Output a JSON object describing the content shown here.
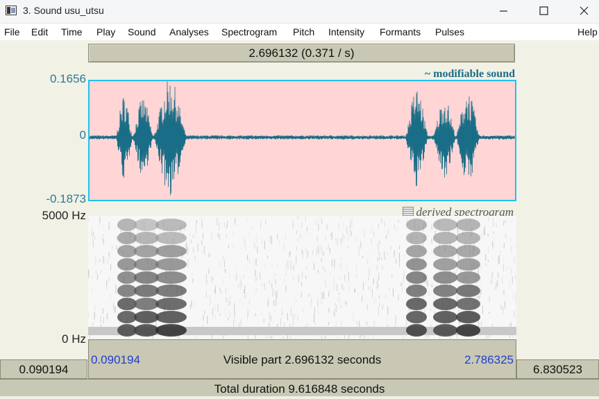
{
  "window": {
    "title": "3. Sound usu_utsu"
  },
  "menu": [
    "File",
    "Edit",
    "Time",
    "Play",
    "Sound",
    "Analyses",
    "Spectrogram",
    "Pitch",
    "Intensity",
    "Formants",
    "Pulses",
    "Help"
  ],
  "selection": {
    "duration_text": "2.696132 (0.371 / s)"
  },
  "waveform": {
    "label": "~ modifiable sound",
    "y_max": "0.1656",
    "y_zero": "0",
    "y_min": "-0.1873",
    "fill_color": "#ffd5d5",
    "wave_color": "#1a6d86"
  },
  "spectrogram": {
    "label": "derived spectrogram",
    "top_freq": "5000 Hz",
    "bottom_freq": "0 Hz"
  },
  "visible": {
    "start": "0.090194",
    "label": "Visible part 2.696132 seconds",
    "end": "2.786325"
  },
  "window_start": "0.090194",
  "window_end": "6.830523",
  "total": "Total duration 9.616848 seconds"
}
